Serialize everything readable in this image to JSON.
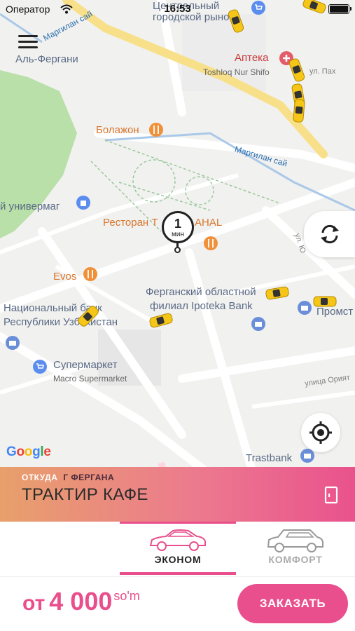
{
  "status_bar": {
    "carrier": "Оператор",
    "time": "16:53",
    "battery_level": 1.0
  },
  "map": {
    "labels": {
      "central_market_1": "Центральный",
      "central_market_2": "городской рынок",
      "pharmacy": "Аптека",
      "pharmacy_sub": "Toshloq Nur Shifo",
      "street_pax": "ул. Пах",
      "al_fergani": "Аль-Фергани",
      "bolazhon": "Болажон",
      "margilan_st": "Маргилан сай",
      "margilan_st_top": "Маргилан сай",
      "univermag": "й универмаг",
      "restaurant": "Ресторан Т",
      "restaurant_end": "AHAL",
      "street_ul": "ул. Ю",
      "evos": "Evos",
      "ipoteka_1": "Ферганский областной",
      "ipoteka_2": "филиал Ipoteka Bank",
      "natsbank_1": "Национальный банк",
      "natsbank_2": "Республики Узбекистан",
      "promst": "Промст",
      "supermarket": "Супермаркет",
      "supermarket_sub": "Macro Supermarket",
      "street_oriyat": "улица Орият",
      "trastbank": "Trastbank",
      "google": "Google"
    },
    "pin": {
      "eta_value": "1",
      "eta_unit": "мин"
    }
  },
  "from": {
    "label": "ОТКУДА",
    "city": "Г ФЕРГАНА",
    "place": "ТРАКТИР КАФЕ"
  },
  "tariffs": [
    {
      "label": "ЭКОНОМ",
      "selected": true
    },
    {
      "label": "КОМФОРТ",
      "selected": false
    }
  ],
  "order": {
    "price_prefix": "от",
    "price_value": "4 000",
    "currency": "so'm",
    "button_label": "ЗАКАЗАТЬ"
  },
  "colors": {
    "accent": "#e94f8c",
    "taxi": "#f5c518"
  }
}
